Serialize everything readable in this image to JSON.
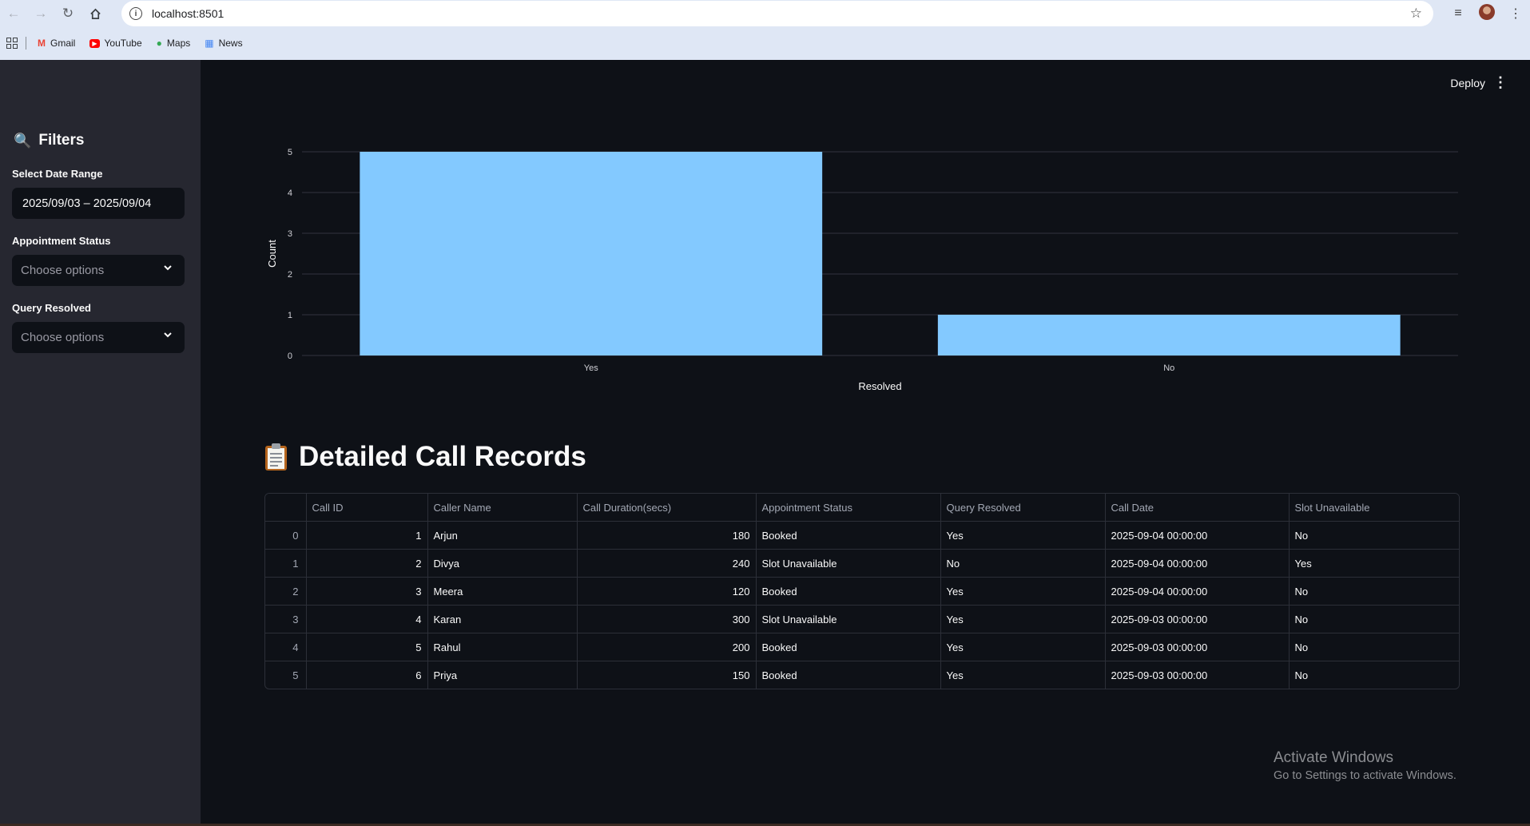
{
  "browser": {
    "url": "localhost:8501",
    "bookmarks": [
      {
        "label": "Gmail",
        "icon": "gmail-icon"
      },
      {
        "label": "YouTube",
        "icon": "youtube-icon"
      },
      {
        "label": "Maps",
        "icon": "maps-icon"
      },
      {
        "label": "News",
        "icon": "news-icon"
      }
    ]
  },
  "sidebar": {
    "title": "Filters",
    "date_label": "Select Date Range",
    "date_value": "2025/09/03 – 2025/09/04",
    "appointment_label": "Appointment Status",
    "appointment_placeholder": "Choose options",
    "query_label": "Query Resolved",
    "query_placeholder": "Choose options"
  },
  "header": {
    "deploy_label": "Deploy"
  },
  "chart_data": {
    "type": "bar",
    "categories": [
      "Yes",
      "No"
    ],
    "values": [
      5,
      1
    ],
    "xlabel": "Resolved",
    "ylabel": "Count",
    "ylim": [
      0,
      5
    ],
    "yticks": [
      "0",
      "1",
      "2",
      "3",
      "4",
      "5"
    ],
    "color": "#83c9ff",
    "grid": true
  },
  "records": {
    "title": "Detailed Call Records",
    "columns": [
      "",
      "Call ID",
      "Caller Name",
      "Call Duration(secs)",
      "Appointment Status",
      "Query Resolved",
      "Call Date",
      "Slot Unavailable"
    ],
    "rows": [
      [
        "0",
        "1",
        "Arjun",
        "180",
        "Booked",
        "Yes",
        "2025-09-04 00:00:00",
        "No"
      ],
      [
        "1",
        "2",
        "Divya",
        "240",
        "Slot Unavailable",
        "No",
        "2025-09-04 00:00:00",
        "Yes"
      ],
      [
        "2",
        "3",
        "Meera",
        "120",
        "Booked",
        "Yes",
        "2025-09-04 00:00:00",
        "No"
      ],
      [
        "3",
        "4",
        "Karan",
        "300",
        "Slot Unavailable",
        "Yes",
        "2025-09-03 00:00:00",
        "No"
      ],
      [
        "4",
        "5",
        "Rahul",
        "200",
        "Booked",
        "Yes",
        "2025-09-03 00:00:00",
        "No"
      ],
      [
        "5",
        "6",
        "Priya",
        "150",
        "Booked",
        "Yes",
        "2025-09-03 00:00:00",
        "No"
      ]
    ]
  },
  "watermark": {
    "line1": "Activate Windows",
    "line2": "Go to Settings to activate Windows."
  }
}
